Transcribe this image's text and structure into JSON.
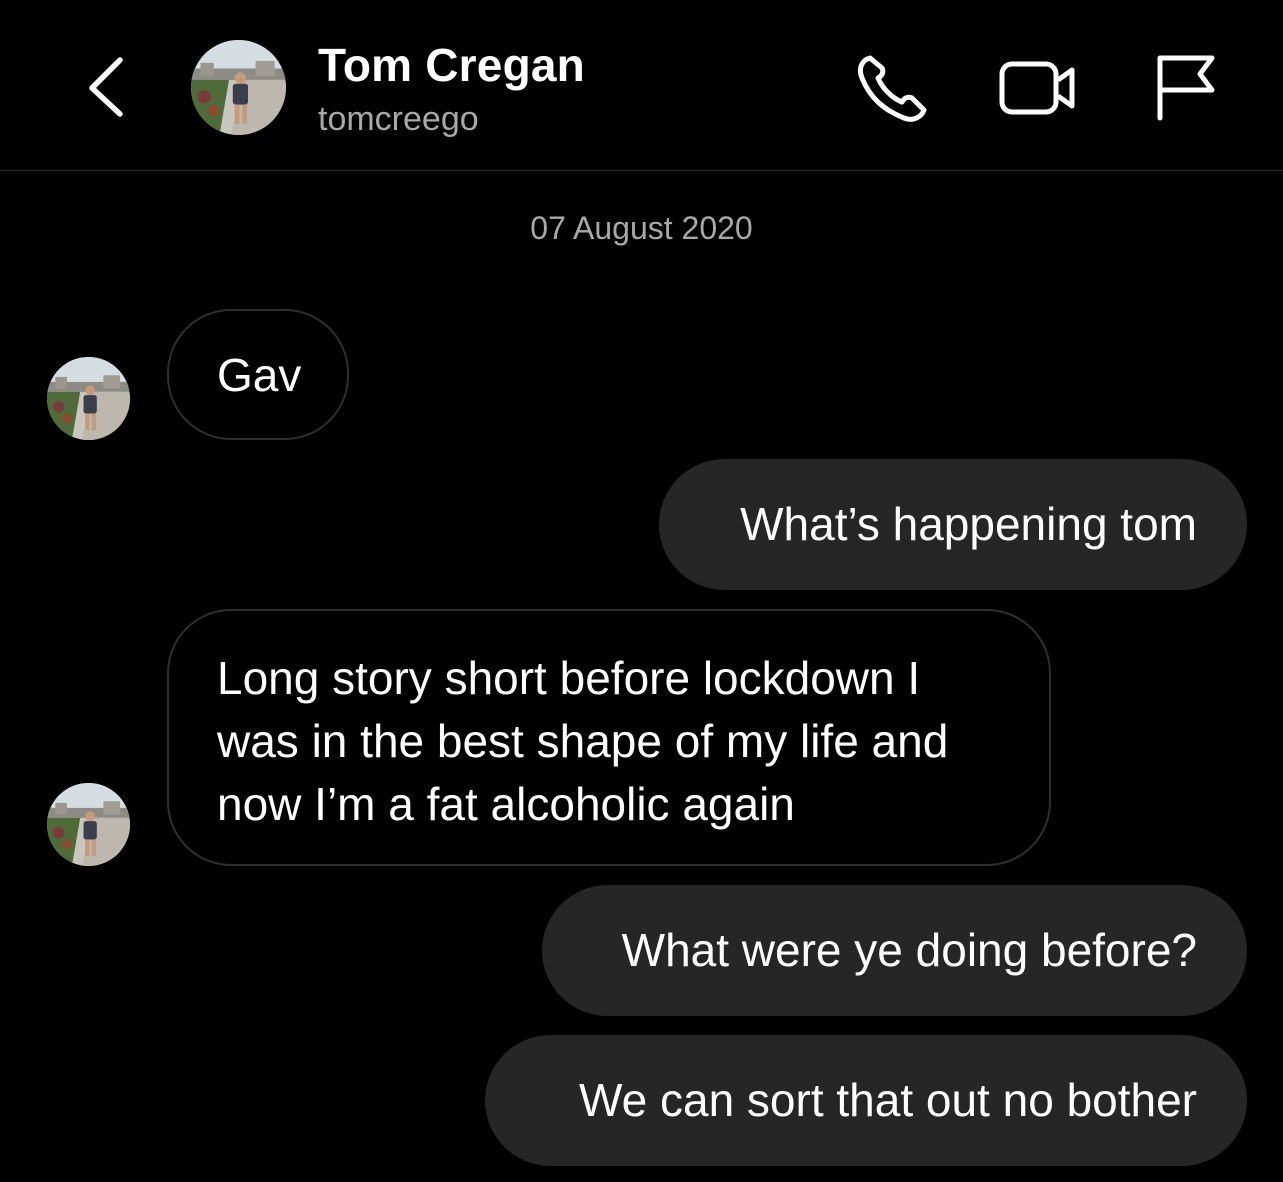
{
  "header": {
    "name": "Tom Cregan",
    "handle": "tomcreego",
    "icons": [
      "back-chevron-icon",
      "phone-icon",
      "video-camera-icon",
      "flag-icon"
    ]
  },
  "thread": {
    "date": "07 August 2020",
    "messages": [
      {
        "sender": "contact",
        "text": "Gav"
      },
      {
        "sender": "me",
        "text": "What’s happening tom"
      },
      {
        "sender": "contact",
        "lines": [
          "Long story short before lockdown I",
          "was in the best shape of my life and",
          "now I’m a fat alcoholic again"
        ]
      },
      {
        "sender": "me",
        "text": "What were ye doing before?"
      },
      {
        "sender": "me",
        "text": "We can sort that out no bother"
      }
    ]
  },
  "colors": {
    "background": "#000000",
    "outgoing_bubble": "#262626",
    "incoming_border": "#2f2f2f",
    "secondary_text": "#a8a8a8",
    "text": "#ffffff"
  }
}
